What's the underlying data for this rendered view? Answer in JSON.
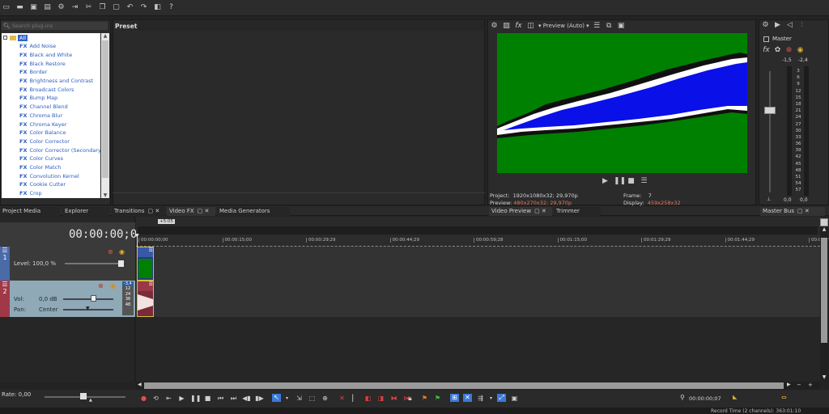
{
  "toolbar": {
    "icons": [
      "new-icon",
      "open-icon",
      "save-icon",
      "save-as-icon",
      "properties-icon",
      "render-icon",
      "cut-icon",
      "copy-icon",
      "paste-icon",
      "undo-icon",
      "redo-icon",
      "snapshot-icon",
      "help-icon"
    ]
  },
  "plugins": {
    "search_placeholder": "Search plug-ins",
    "root_label": "All",
    "items": [
      "Add Noise",
      "Black and White",
      "Black Restore",
      "Border",
      "Brightness and Contrast",
      "Broadcast Colors",
      "Bump Map",
      "Channel Blend",
      "Chroma Blur",
      "Chroma Keyer",
      "Color Balance",
      "Color Corrector",
      "Color Corrector (Secondary)",
      "Color Curves",
      "Color Match",
      "Convolution Kernel",
      "Cookie Cutter",
      "Crop"
    ],
    "fx_badge": "FX"
  },
  "preset": {
    "label": "Preset:"
  },
  "dock_tabs": {
    "project_media": "Project Media",
    "explorer": "Explorer",
    "transitions": "Transitions",
    "video_fx": "Video FX",
    "media_generators": "Media Generators",
    "video_preview": "Video Preview",
    "trimmer": "Trimmer",
    "master_bus": "Master Bus"
  },
  "preview": {
    "mode": "Preview (Auto)",
    "project_label": "Project:",
    "project_value": "1920x1080x32; 29,970p",
    "preview_label": "Preview:",
    "preview_value": "480x270x32; 29,970p",
    "frame_label": "Frame:",
    "frame_value": "7",
    "display_label": "Display:",
    "display_value": "459x258x32",
    "colors": {
      "green": "#008000",
      "blue": "#0a10e8"
    }
  },
  "master": {
    "label": "Master",
    "peak_left": "-1,5",
    "peak_right": "-2,4",
    "scale": [
      "3",
      "6",
      "9",
      "12",
      "15",
      "18",
      "21",
      "24",
      "27",
      "30",
      "33",
      "36",
      "39",
      "42",
      "45",
      "48",
      "51",
      "54",
      "57"
    ],
    "value_left": "0,0",
    "value_right": "0,0"
  },
  "timeline": {
    "timecode": "00:00:00;07",
    "position_badge": "+5:05",
    "ruler": [
      "00:00:00;00",
      "00:00:15;00",
      "00:00:29;29",
      "00:00:44;29",
      "00:00:59;28",
      "00:01:15;00",
      "00:01:29;29",
      "00:01:44;29",
      "00:01:59"
    ],
    "video_track": {
      "number": "1",
      "level_label": "Level: 100,0 %",
      "level": 1.0
    },
    "audio_track": {
      "number": "2",
      "vol_label": "Vol:",
      "vol_value": "0,0 dB",
      "pan_label": "Pan:",
      "pan_value": "Center",
      "meter_top": "-3,4",
      "meter_scale": [
        "12",
        "24",
        "36",
        "48"
      ]
    },
    "rate_label": "Rate: 0,00",
    "end_timecode": "00:00:00;07",
    "status": "Record Time (2 channels): 363:01:10"
  }
}
